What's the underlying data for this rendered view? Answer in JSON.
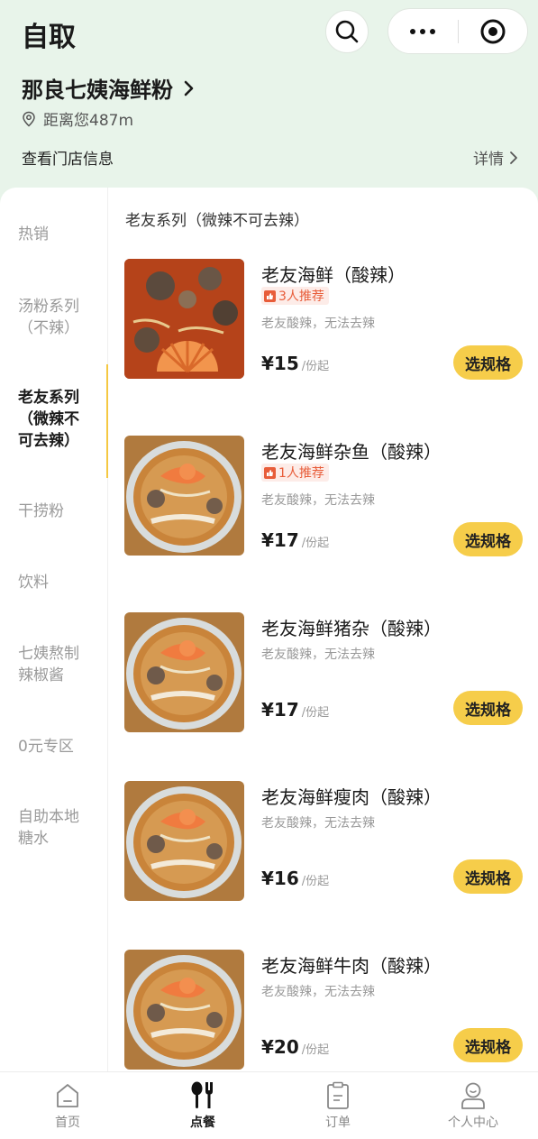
{
  "header": {
    "title": "自取",
    "store_name": "那良七姨海鲜粉",
    "distance": "距离您487m",
    "store_info": "查看门店信息",
    "detail_link": "详情"
  },
  "sidebar": {
    "items": [
      {
        "label": "热销"
      },
      {
        "label": "汤粉系列（不辣）"
      },
      {
        "label": "老友系列（微辣不可去辣）"
      },
      {
        "label": "干捞粉"
      },
      {
        "label": "饮料"
      },
      {
        "label": "七姨熬制辣椒酱"
      },
      {
        "label": "0元专区"
      },
      {
        "label": "自助本地糖水"
      }
    ]
  },
  "menu": {
    "section_title": "老友系列（微辣不可去辣）",
    "spec_label": "选规格",
    "products": [
      {
        "name": "老友海鲜（酸辣）",
        "badge": "3人推荐",
        "desc": "老友酸辣，无法去辣",
        "price": "¥15",
        "unit": "/份起"
      },
      {
        "name": "老友海鲜杂鱼（酸辣）",
        "badge": "1人推荐",
        "desc": "老友酸辣，无法去辣",
        "price": "¥17",
        "unit": "/份起"
      },
      {
        "name": "老友海鲜猪杂（酸辣）",
        "badge": "",
        "desc": "老友酸辣，无法去辣",
        "price": "¥17",
        "unit": "/份起"
      },
      {
        "name": "老友海鲜瘦肉（酸辣）",
        "badge": "",
        "desc": "老友酸辣，无法去辣",
        "price": "¥16",
        "unit": "/份起"
      },
      {
        "name": "老友海鲜牛肉（酸辣）",
        "badge": "",
        "desc": "老友酸辣，无法去辣",
        "price": "¥20",
        "unit": "/份起"
      }
    ]
  },
  "tabbar": {
    "items": [
      {
        "label": "首页",
        "icon": "home-icon"
      },
      {
        "label": "点餐",
        "icon": "cutlery-icon"
      },
      {
        "label": "订单",
        "icon": "clipboard-icon"
      },
      {
        "label": "个人中心",
        "icon": "user-icon"
      }
    ]
  },
  "colors": {
    "header_bg": "#e8f4ea",
    "accent": "#f6cd4a",
    "badge": "#e85d3a"
  }
}
